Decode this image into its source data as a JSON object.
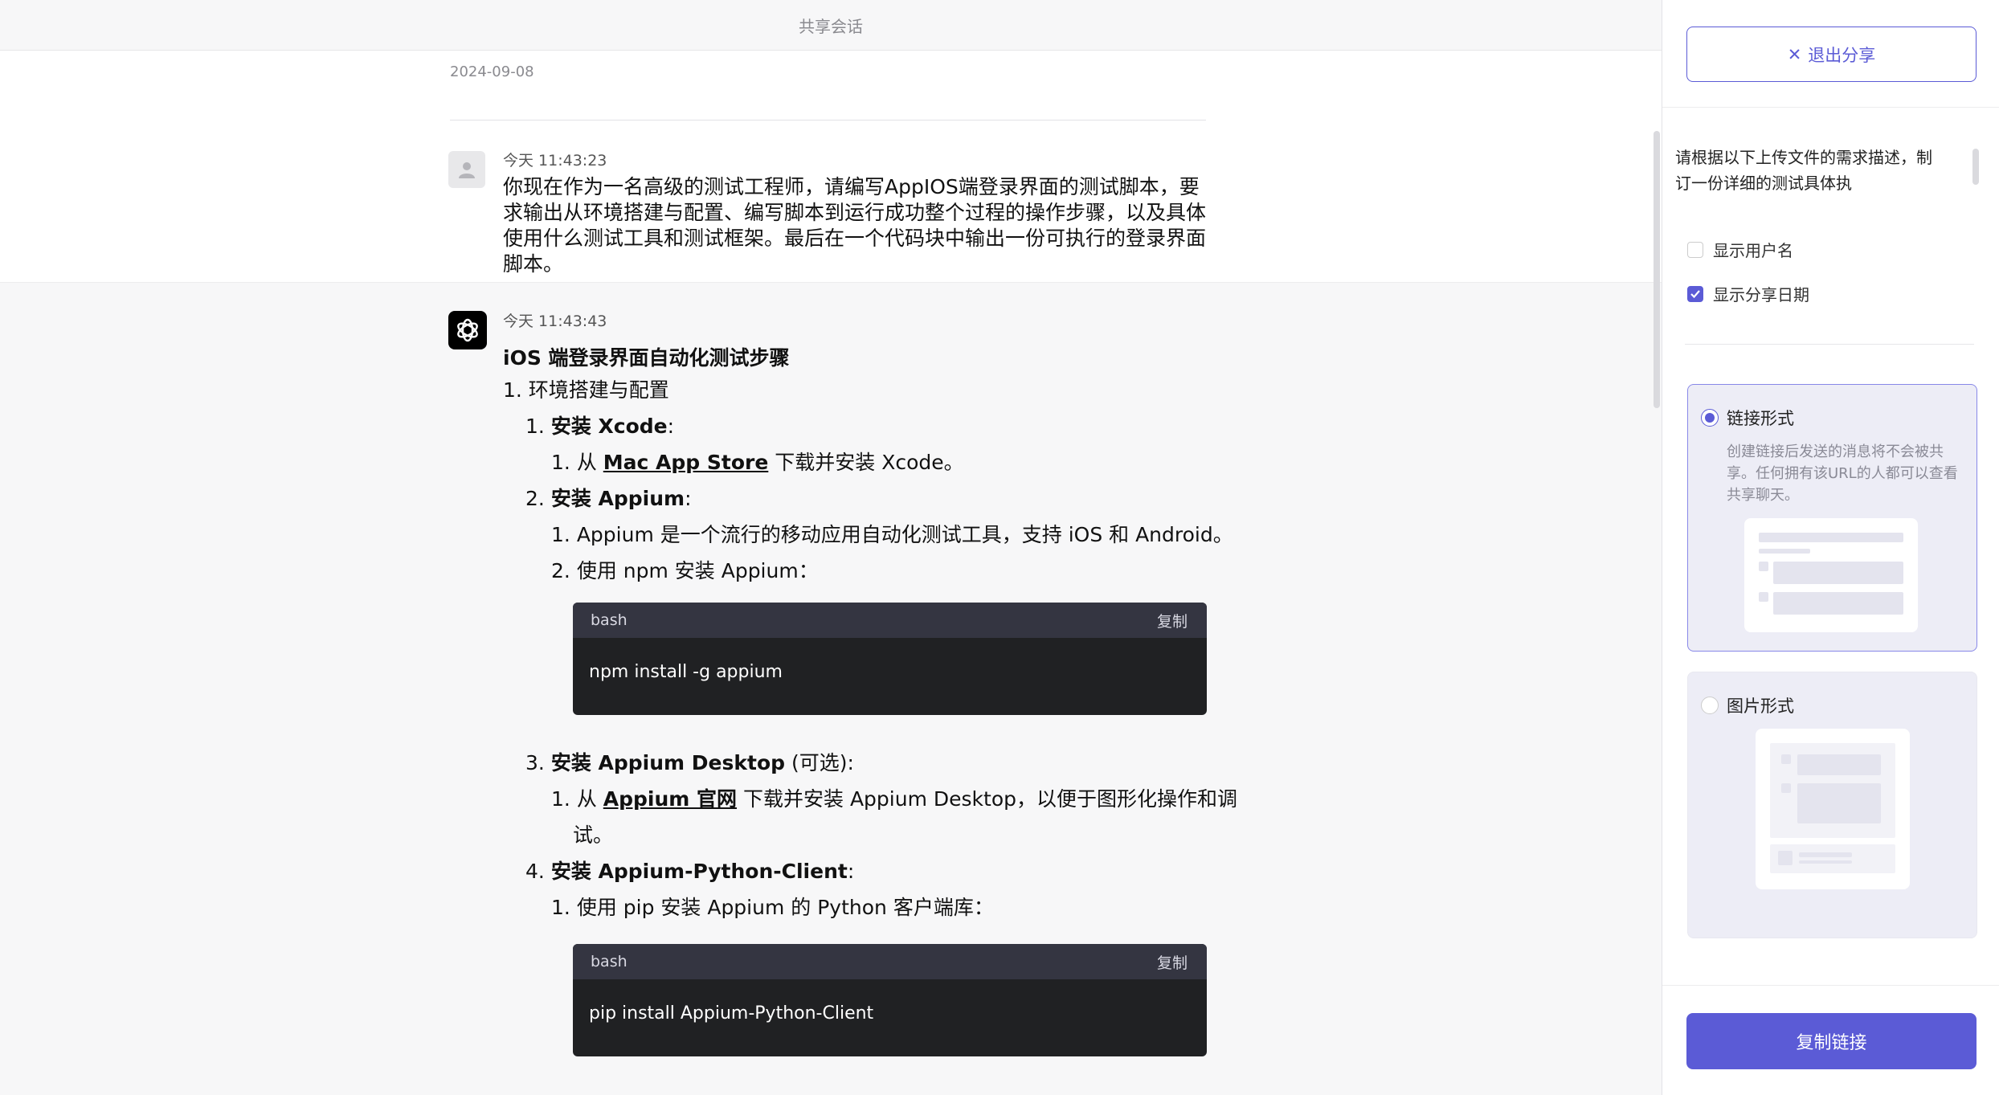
{
  "topbar": {
    "title": "共享会话"
  },
  "chat": {
    "date": "2024-09-08",
    "user": {
      "time": "今天 11:43:23",
      "text": "你现在作为一名高级的测试工程师，请编写AppIOS端登录界面的测试脚本，要求输出从环境搭建与配置、编写脚本到运行成功整个过程的操作步骤，以及具体使用什么测试工具和测试框架。最后在一个代码块中输出一份可执行的登录界面脚本。"
    },
    "ai": {
      "time": "今天 11:43:43",
      "heading": "iOS 端登录界面自动化测试步骤",
      "step1": "1. 环境搭建与配置",
      "s1": {
        "num": "1.",
        "title": "安装 Xcode",
        "suffix": ":"
      },
      "s1_1": {
        "num": "1.",
        "pre": "从",
        "link": "Mac App Store",
        "post": "下载并安装 Xcode。"
      },
      "s2": {
        "num": "2.",
        "title": "安装 Appium",
        "suffix": ":"
      },
      "s2_1": {
        "num": "1.",
        "text": "Appium 是一个流行的移动应用自动化测试工具，支持 iOS 和 Android。"
      },
      "s2_2": {
        "num": "2.",
        "text": "使用 npm 安装 Appium："
      },
      "code1": {
        "lang": "bash",
        "copy": "复制",
        "code": "npm install -g appium"
      },
      "s3": {
        "num": "3.",
        "title": "安装 Appium Desktop",
        "suffix": " (可选):"
      },
      "s3_1": {
        "num": "1.",
        "pre": "从",
        "link": "Appium 官网",
        "post": "下载并安装 Appium Desktop，以便于图形化操作和调",
        "cont": "试。"
      },
      "s4": {
        "num": "4.",
        "title": "安装 Appium-Python-Client",
        "suffix": ":"
      },
      "s4_1": {
        "num": "1.",
        "text": "使用 pip 安装 Appium 的 Python 客户端库："
      },
      "code2": {
        "lang": "bash",
        "copy": "复制",
        "code": "pip install Appium-Python-Client"
      }
    }
  },
  "panel": {
    "exit_label": "退出分享",
    "summary": "请根据以下上传文件的需求描述，制订一份详细的测试具体执",
    "show_username": {
      "label": "显示用户名",
      "checked": false
    },
    "show_date": {
      "label": "显示分享日期",
      "checked": true
    },
    "link_option": {
      "label": "链接形式",
      "desc": "创建链接后发送的消息将不会被共享。任何拥有该URL的人都可以查看共享聊天。",
      "selected": true
    },
    "image_option": {
      "label": "图片形式",
      "selected": false
    },
    "copy_label": "复制链接"
  }
}
